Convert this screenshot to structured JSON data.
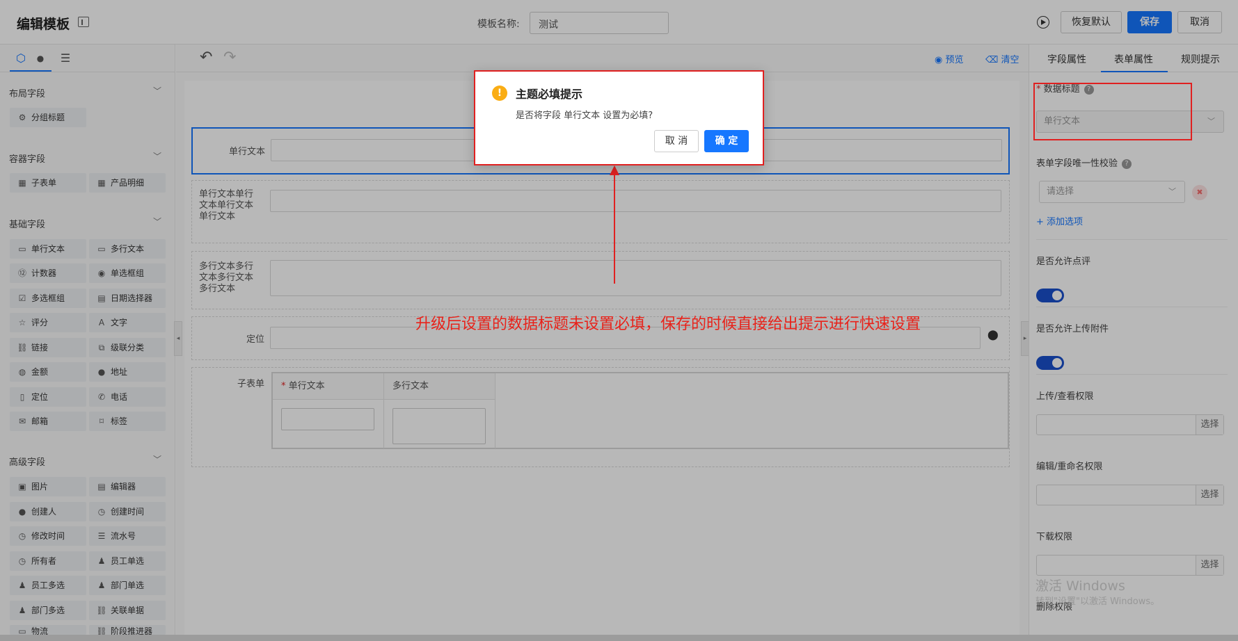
{
  "header": {
    "title": "编辑模板",
    "name_label": "模板名称:",
    "name_value": "测试",
    "restore": "恢复默认",
    "save": "保存",
    "cancel": "取消"
  },
  "left": {
    "sections": [
      {
        "title": "布局字段",
        "items": [
          "分组标题"
        ]
      },
      {
        "title": "容器字段",
        "items": [
          "子表单",
          "产品明细"
        ]
      },
      {
        "title": "基础字段",
        "items": [
          "单行文本",
          "多行文本",
          "计数器",
          "单选框组",
          "多选框组",
          "日期选择器",
          "评分",
          "文字",
          "链接",
          "级联分类",
          "金额",
          "地址",
          "定位",
          "电话",
          "邮箱",
          "标签"
        ]
      },
      {
        "title": "高级字段",
        "items": [
          "图片",
          "编辑器",
          "创建人",
          "创建时间",
          "修改时间",
          "流水号",
          "所有者",
          "员工单选",
          "员工多选",
          "部门单选",
          "部门多选",
          "关联单据",
          "物流",
          "阶段推进器"
        ]
      }
    ]
  },
  "canvas": {
    "preview": "预览",
    "clear": "清空",
    "fields": {
      "single": "单行文本",
      "longlabel": "单行文本单行文本单行文本单行文本",
      "multi": "多行文本多行文本多行文本多行文本",
      "location": "定位",
      "subform": "子表单",
      "sub_col1": "单行文本",
      "sub_col2": "多行文本"
    }
  },
  "right": {
    "tabs": [
      "字段属性",
      "表单属性",
      "规则提示"
    ],
    "data_title_label": "数据标题",
    "data_title_value": "单行文本",
    "unique_label": "表单字段唯一性校验",
    "unique_placeholder": "请选择",
    "add_option": "+ 添加选项",
    "allow_comment": "是否允许点评",
    "allow_upload": "是否允许上传附件",
    "upload_perm": "上传/查看权限",
    "rename_perm": "编辑/重命名权限",
    "download_perm": "下载权限",
    "delete_perm": "删除权限",
    "pick": "选择"
  },
  "dialog": {
    "title": "主题必填提示",
    "message": "是否将字段 单行文本 设置为必填?",
    "cancel": "取 消",
    "ok": "确 定"
  },
  "annotation": "升级后设置的数据标题未设置必填，保存的时候直接给出提示进行快速设置",
  "watermark": {
    "line1": "激活 Windows",
    "line2": "转到\"设置\"以激活 Windows。"
  },
  "colors": {
    "primary": "#1677ff",
    "annotation": "#e02020",
    "toggle": "#1a4fcc"
  }
}
